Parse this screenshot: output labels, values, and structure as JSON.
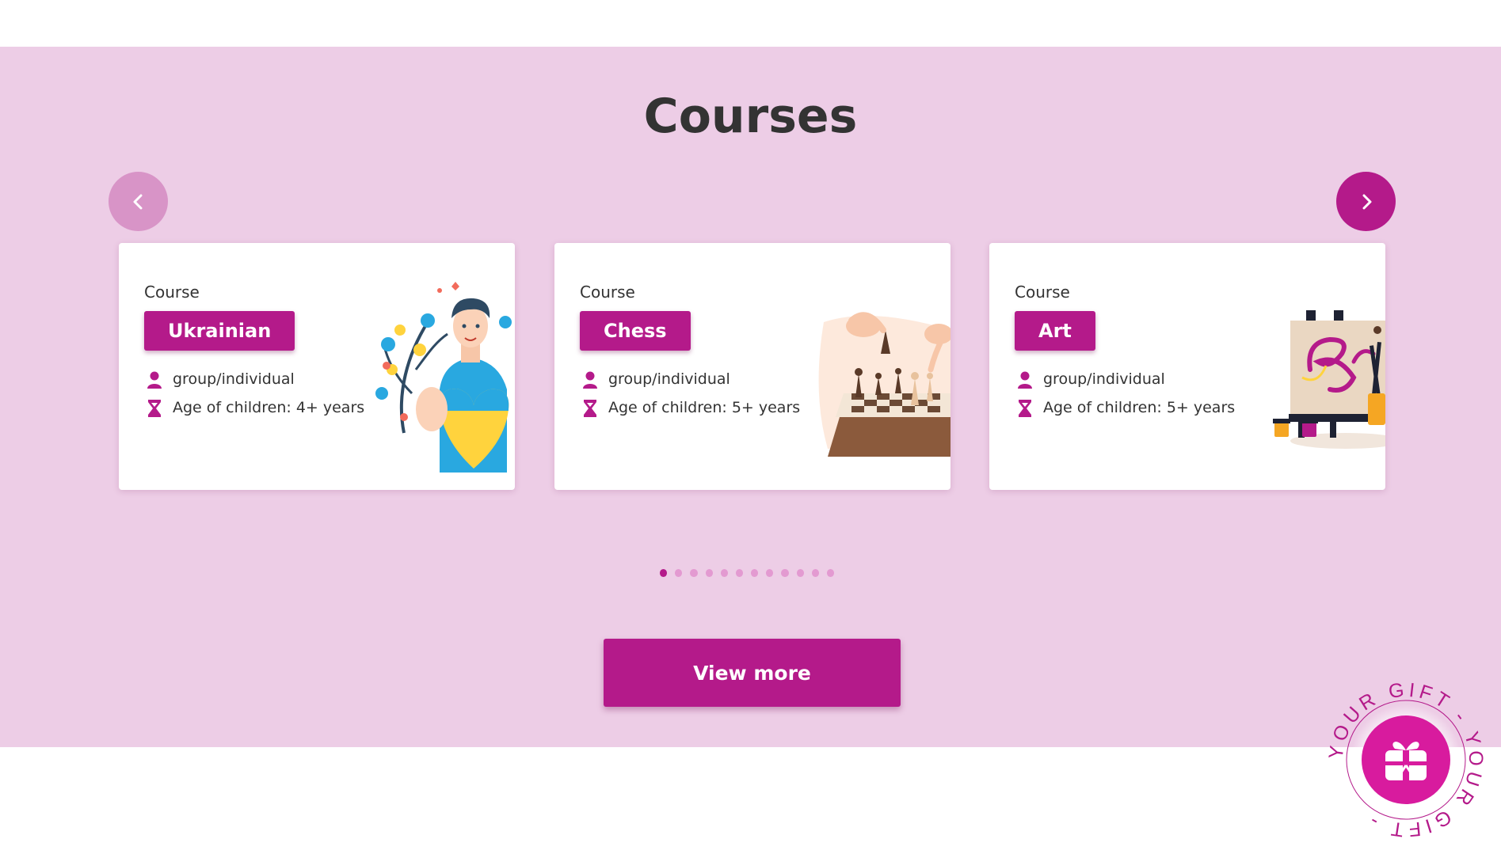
{
  "section": {
    "title": "Courses"
  },
  "carousel": {
    "prev_icon": "chevron-left-icon",
    "next_icon": "chevron-right-icon",
    "dot_count": 12,
    "active_index": 0,
    "cards": [
      {
        "kind": "Course",
        "name": "Ukrainian",
        "format": "group/individual",
        "age": "Age of children: 4+ years",
        "illustration": "ukrainian-illustration"
      },
      {
        "kind": "Course",
        "name": "Chess",
        "format": "group/individual",
        "age": "Age of children: 5+ years",
        "illustration": "chess-illustration"
      },
      {
        "kind": "Course",
        "name": "Art",
        "format": "group/individual",
        "age": "Age of children: 5+ years",
        "illustration": "art-illustration"
      }
    ]
  },
  "view_more": {
    "label": "View more"
  },
  "gift_badge": {
    "ring_text": "YOUR GIFT - YOUR GIFT - ",
    "icon": "gift-icon"
  },
  "colors": {
    "band": "#edcde6",
    "accent": "#b41a8a",
    "accent_light": "#d894c7",
    "dot": "#e39ad1"
  }
}
